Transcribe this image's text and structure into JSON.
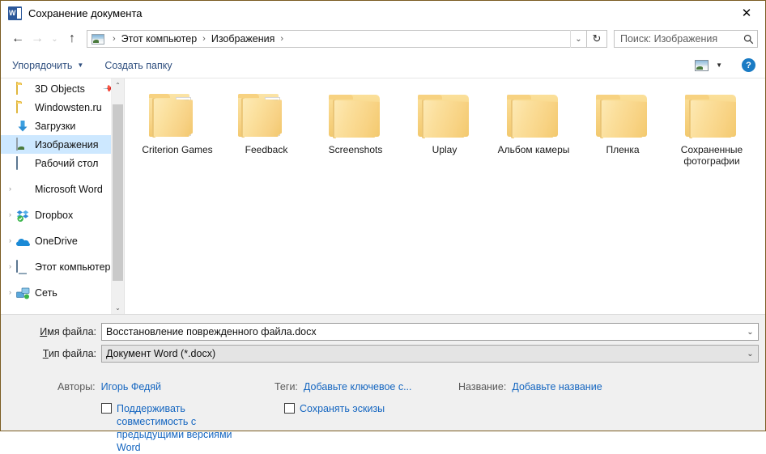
{
  "window": {
    "title": "Сохранение документа",
    "app_icon": "word-icon",
    "close_label": "✕",
    "border_color": "#7a5c22"
  },
  "nav": {
    "back_icon": "←",
    "forward_icon": "→",
    "recent_icon": "⌄",
    "up_icon": "↑",
    "refresh_icon": "↻",
    "breadcrumb": {
      "location_icon": "pictures-icon",
      "items": [
        "Этот компьютер",
        "Изображения"
      ],
      "separator": "›"
    },
    "address_dropdown_icon": "⌄"
  },
  "search": {
    "placeholder": "Поиск: Изображения",
    "icon": "search-icon"
  },
  "toolbar": {
    "organize_label": "Упорядочить",
    "organize_caret": "▼",
    "new_folder_label": "Создать папку",
    "view_icon": "view-layout-icon",
    "view_caret": "▼",
    "help_icon": "?",
    "help_label": "Справка"
  },
  "sidebar": {
    "items": [
      {
        "label": "3D Objects",
        "icon": "folder-icon",
        "expander": "",
        "selected": false,
        "pinned": true
      },
      {
        "label": "Windowsten.ru",
        "icon": "folder-icon",
        "expander": "",
        "selected": false,
        "pinned": false
      },
      {
        "label": "Загрузки",
        "icon": "download-icon",
        "expander": "",
        "selected": false,
        "pinned": false
      },
      {
        "label": "Изображения",
        "icon": "pictures-icon",
        "expander": "",
        "selected": true,
        "pinned": false
      },
      {
        "label": "Рабочий стол",
        "icon": "desktop-icon",
        "expander": "",
        "selected": false,
        "pinned": false
      },
      {
        "label": "Microsoft Word",
        "icon": "word-icon",
        "expander": "›",
        "selected": false,
        "pinned": false
      },
      {
        "label": "Dropbox",
        "icon": "dropbox-icon",
        "expander": "›",
        "selected": false,
        "pinned": false
      },
      {
        "label": "OneDrive",
        "icon": "onedrive-icon",
        "expander": "›",
        "selected": false,
        "pinned": false
      },
      {
        "label": "Этот компьютер",
        "icon": "computer-icon",
        "expander": "›",
        "selected": false,
        "pinned": false
      },
      {
        "label": "Сеть",
        "icon": "network-icon",
        "expander": "›",
        "selected": false,
        "pinned": false
      }
    ],
    "scroll": {
      "up_icon": "⌃",
      "down_icon": "⌄"
    }
  },
  "content": {
    "folders": [
      {
        "label": "Criterion Games",
        "has_preview": true
      },
      {
        "label": "Feedback",
        "has_preview": true
      },
      {
        "label": "Screenshots",
        "has_preview": false
      },
      {
        "label": "Uplay",
        "has_preview": false
      },
      {
        "label": "Альбом камеры",
        "has_preview": false
      },
      {
        "label": "Пленка",
        "has_preview": false
      },
      {
        "label": "Сохраненные фотографии",
        "has_preview": false
      }
    ]
  },
  "form": {
    "filename": {
      "label_first": "И",
      "label_rest": "мя файла:",
      "value": "Восстановление поврежденного файла.docx",
      "chevron": "⌄"
    },
    "filetype": {
      "label_first": "Т",
      "label_rest": "ип файла:",
      "value": "Документ Word (*.docx)",
      "chevron": "⌄"
    },
    "authors": {
      "label": "Авторы:",
      "value": "Игорь Федяй"
    },
    "tags": {
      "label": "Теги:",
      "value": "Добавьте ключевое с..."
    },
    "title": {
      "label": "Название:",
      "value": "Добавьте название"
    },
    "checkbox_compat": {
      "label": "Поддерживать совместимость с предыдущими версиями Word",
      "checked": false
    },
    "checkbox_thumbs": {
      "label": "Сохранять эскизы",
      "checked": false
    }
  }
}
